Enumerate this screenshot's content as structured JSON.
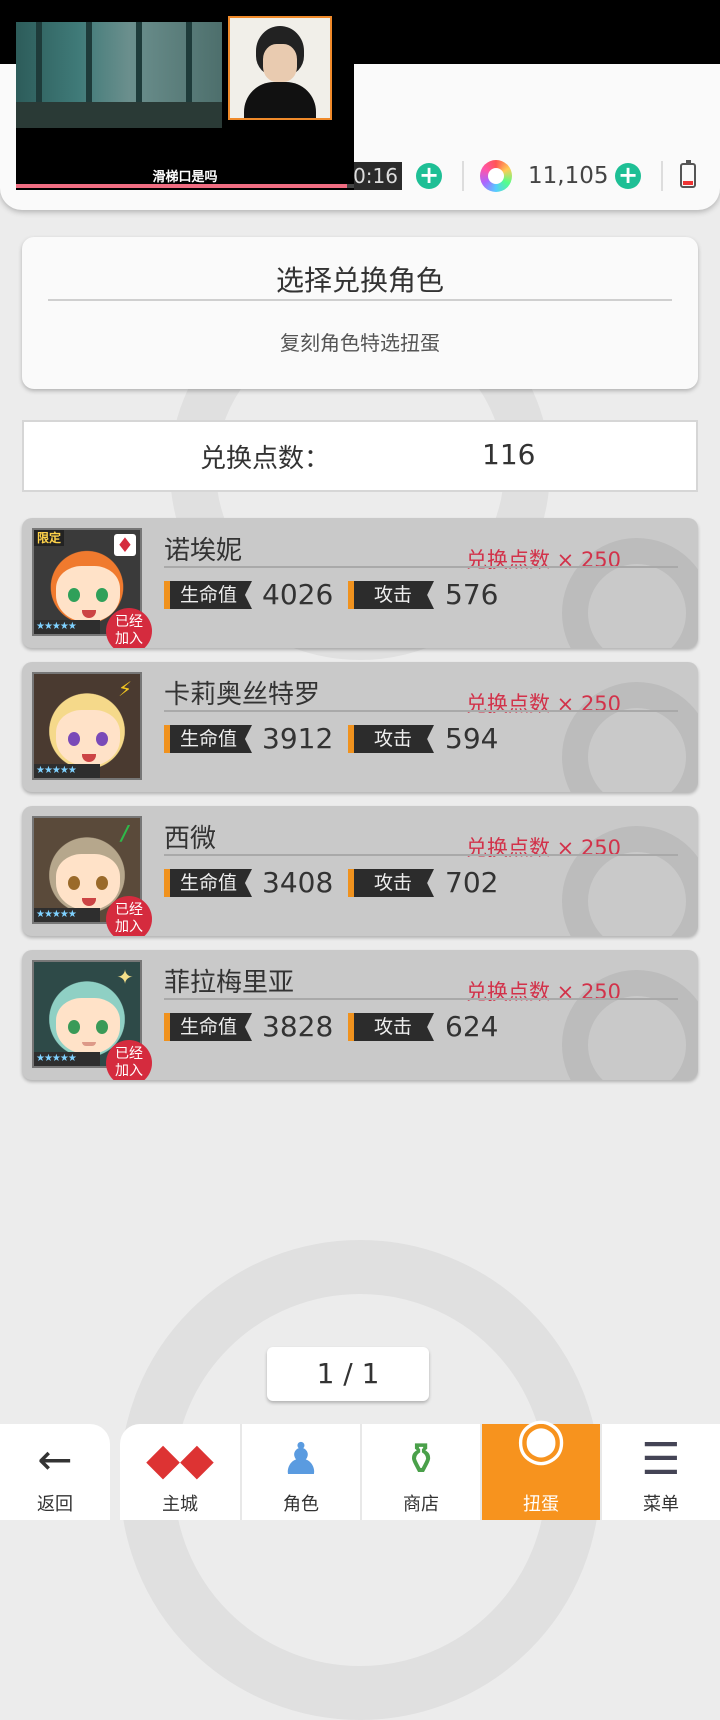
{
  "header": {
    "stamina_value": "00:16",
    "gem_value": "11,105",
    "video_caption": "滑梯口是吗",
    "video_progress": 0.98
  },
  "select_card": {
    "title": "选择兑换角色",
    "subtitle": "复刻角色特选扭蛋"
  },
  "points": {
    "label": "兑换点数：",
    "value": "116"
  },
  "characters": [
    {
      "name": "诺埃妮",
      "cost": "兑换点数 × 250",
      "hp_label": "生命值",
      "hp": "4026",
      "atk_label": "攻击",
      "atk": "576",
      "limited": "限定",
      "joined": "已经加入",
      "stars": "★★★★★",
      "element": "♦"
    },
    {
      "name": "卡莉奥丝特罗",
      "cost": "兑换点数 × 250",
      "hp_label": "生命值",
      "hp": "3912",
      "atk_label": "攻击",
      "atk": "594",
      "stars": "★★★★★",
      "element": "⚡"
    },
    {
      "name": "西微",
      "cost": "兑换点数 × 250",
      "hp_label": "生命值",
      "hp": "3408",
      "atk_label": "攻击",
      "atk": "702",
      "joined": "已经加入",
      "stars": "★★★★★",
      "element": "/"
    },
    {
      "name": "菲拉梅里亚",
      "cost": "兑换点数 × 250",
      "hp_label": "生命值",
      "hp": "3828",
      "atk_label": "攻击",
      "atk": "624",
      "joined": "已经加入",
      "stars": "★★★★★",
      "element": "✦"
    }
  ],
  "pager": "1 / 1",
  "nav": {
    "back": "返回",
    "items": [
      {
        "label": "主城",
        "icon": "castle-icon"
      },
      {
        "label": "角色",
        "icon": "character-icon"
      },
      {
        "label": "商店",
        "icon": "shop-icon"
      },
      {
        "label": "扭蛋",
        "icon": "gacha-icon",
        "active": true
      },
      {
        "label": "菜单",
        "icon": "menu-icon"
      }
    ]
  },
  "colors": {
    "accent_green": "#1ebf95",
    "cost_red": "#d2324a",
    "nav_active": "#f7931e",
    "joined_badge": "#d52b3e"
  }
}
